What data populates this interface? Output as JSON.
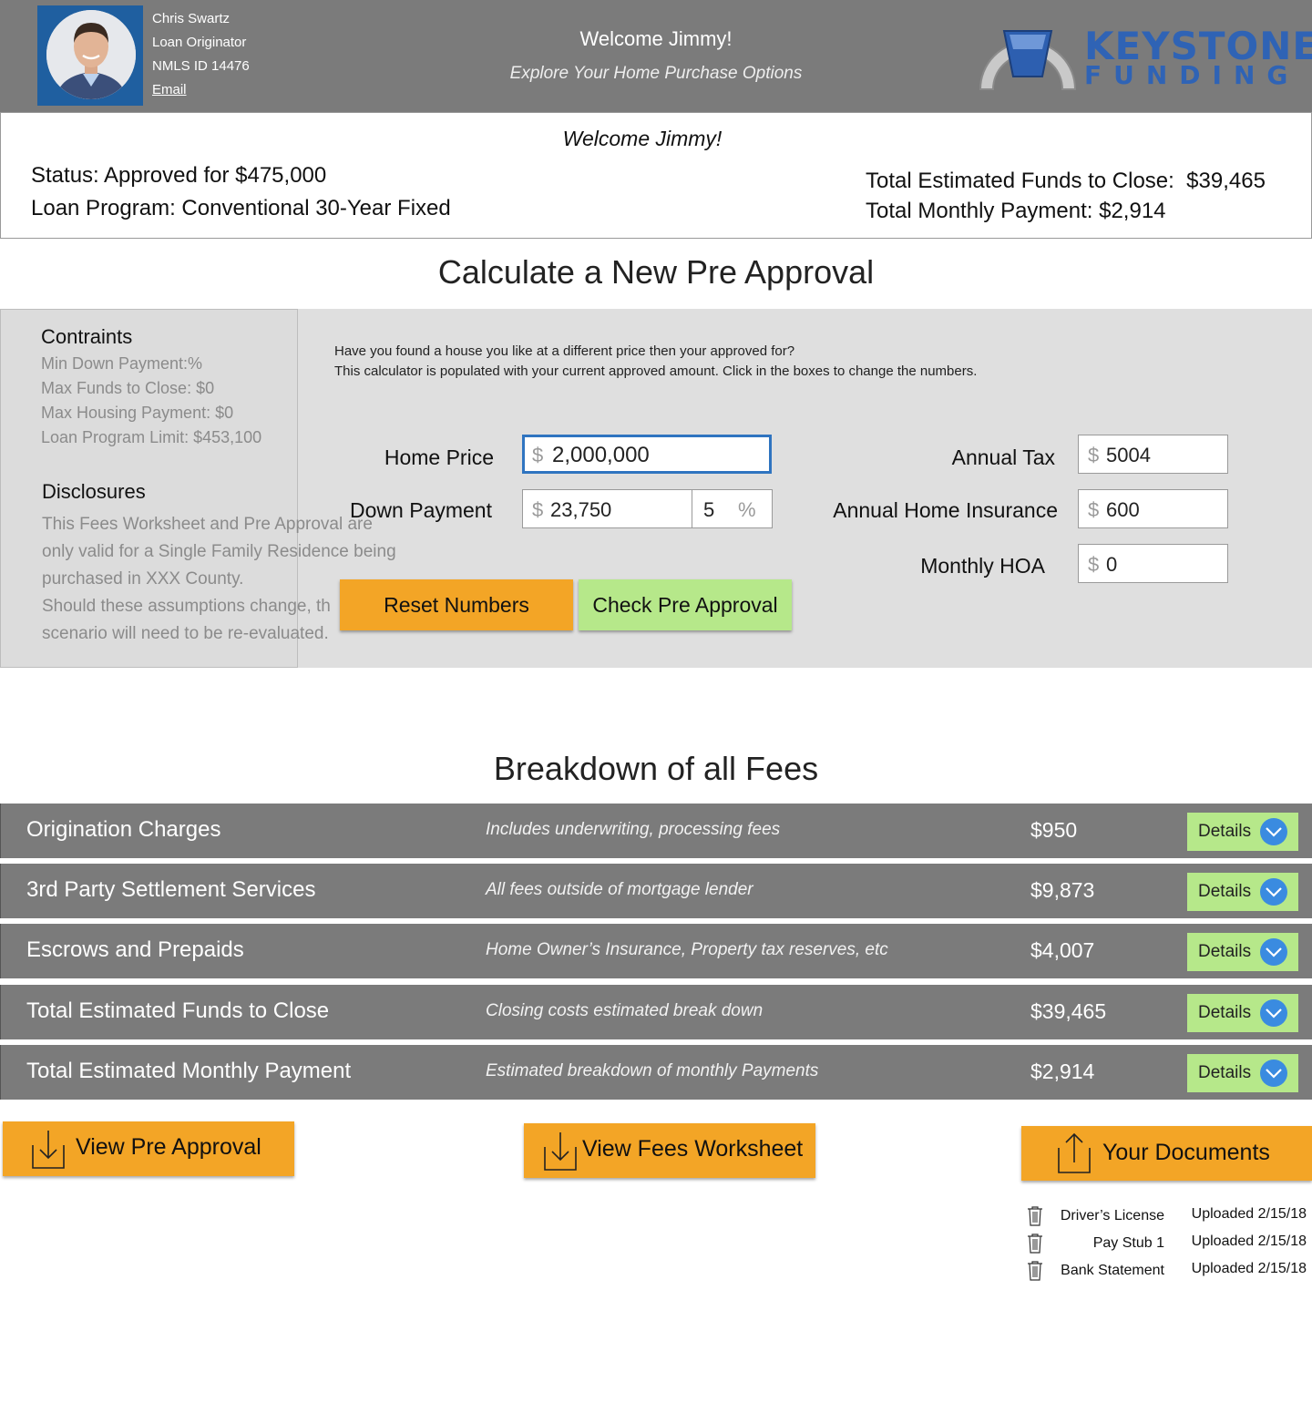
{
  "header": {
    "loan_officer": {
      "name": "Chris Swartz",
      "title": "Loan Originator",
      "nmls": "NMLS ID 14476",
      "email_label": "Email"
    },
    "welcome": "Welcome Jimmy!",
    "tagline": "Explore Your Home Purchase Options",
    "logo": {
      "line1": "KEYSTONE",
      "line2": "FUNDING"
    }
  },
  "status_card": {
    "welcome": "Welcome Jimmy!",
    "status": "Status: Approved for $475,000",
    "loan_program": "Loan Program: Conventional 30-Year Fixed",
    "funds_to_close": "Total Estimated Funds to Close:  $39,465",
    "monthly_payment": "Total Monthly Payment: $2,914"
  },
  "calculator": {
    "title": "Calculate a New Pre Approval",
    "intro_line1": "Have you found a house you like at a different price then your approved for?",
    "intro_line2": "This calculator is populated with your current approved amount. Click in the boxes to change the numbers.",
    "constraints": {
      "heading": "Contraints",
      "items": [
        "Min Down Payment:%",
        "Max Funds to Close: $0",
        "Max Housing Payment: $0",
        "Loan Program Limit: $453,100"
      ]
    },
    "disclosures": {
      "heading": "Disclosures",
      "lines": [
        "This Fees Worksheet and Pre Approval are",
        "only valid for a Single Family Residence being",
        "purchased in XXX County.",
        "Should these assumptions change, th",
        "scenario will need to be re-evaluated."
      ]
    },
    "fields": {
      "home_price": {
        "label": "Home Price",
        "currency": "$",
        "value": "2,000,000"
      },
      "down_payment": {
        "label": "Down Payment",
        "currency": "$",
        "value": "23,750",
        "percent": "5",
        "percent_symbol": "%"
      },
      "annual_tax": {
        "label": "Annual Tax",
        "currency": "$",
        "value": "5004"
      },
      "annual_insurance": {
        "label": "Annual Home Insurance",
        "currency": "$",
        "value": "600"
      },
      "monthly_hoa": {
        "label": "Monthly HOA",
        "currency": "$",
        "value": "0"
      }
    },
    "reset_label": "Reset Numbers",
    "check_label": "Check Pre Approval"
  },
  "fees": {
    "title": "Breakdown of all Fees",
    "details_label": "Details",
    "rows": [
      {
        "name": "Origination Charges",
        "desc": "Includes underwriting, processing fees",
        "amount": "$950"
      },
      {
        "name": "3rd Party Settlement Services",
        "desc": "All fees outside of mortgage lender",
        "amount": "$9,873"
      },
      {
        "name": "Escrows and Prepaids",
        "desc": "Home Owner’s Insurance, Property tax reserves, etc",
        "amount": "$4,007"
      },
      {
        "name": "Total Estimated Funds to Close",
        "desc": "Closing costs estimated break down",
        "amount": "$39,465"
      },
      {
        "name": "Total Estimated Monthly Payment",
        "desc": "Estimated breakdown of monthly Payments",
        "amount": "$2,914"
      }
    ]
  },
  "actions": {
    "view_pre_approval": "View Pre Approval",
    "view_fees_worksheet": "View Fees Worksheet",
    "your_documents": "Your Documents"
  },
  "documents": [
    {
      "name": "Driver’s License",
      "status": "Uploaded 2/15/18"
    },
    {
      "name": "Pay Stub 1",
      "status": "Uploaded 2/15/18"
    },
    {
      "name": "Bank Statement",
      "status": "Uploaded 2/15/18"
    }
  ],
  "colors": {
    "header_bg": "#7b7b7b",
    "orange_button": "#f3a526",
    "green_button": "#b6e88a",
    "brand_blue": "#2f63b5",
    "chevron_blue": "#3a8be0",
    "panel_gray": "#dfdfdf"
  },
  "icons": [
    "avatar",
    "keystone-logo",
    "chevron-down-icon",
    "download-icon",
    "upload-icon",
    "trash-icon"
  ]
}
